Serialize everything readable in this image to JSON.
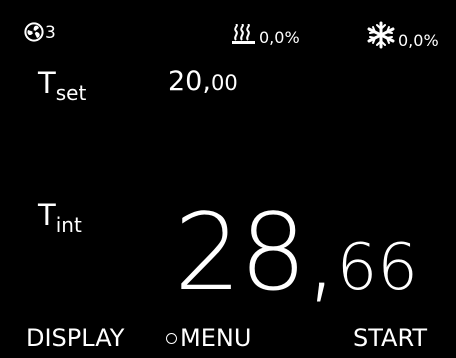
{
  "status": {
    "pump": {
      "icon": "pump-icon",
      "level": "3"
    },
    "heating": {
      "icon": "heating-icon",
      "percent": "0,0%"
    },
    "cooling": {
      "icon": "cooling-icon",
      "percent": "0,0%"
    }
  },
  "setpoint": {
    "label_main": "T",
    "label_sub": "set",
    "value_int": "20,",
    "value_dec": "00"
  },
  "internal": {
    "label_main": "T",
    "label_sub": "int",
    "value_int": "28,",
    "value_dec": "66"
  },
  "softkeys": {
    "left": "DISPLAY",
    "center": "MENU",
    "right": "START"
  },
  "colors": {
    "background": "#000000",
    "foreground": "#ffffff"
  }
}
